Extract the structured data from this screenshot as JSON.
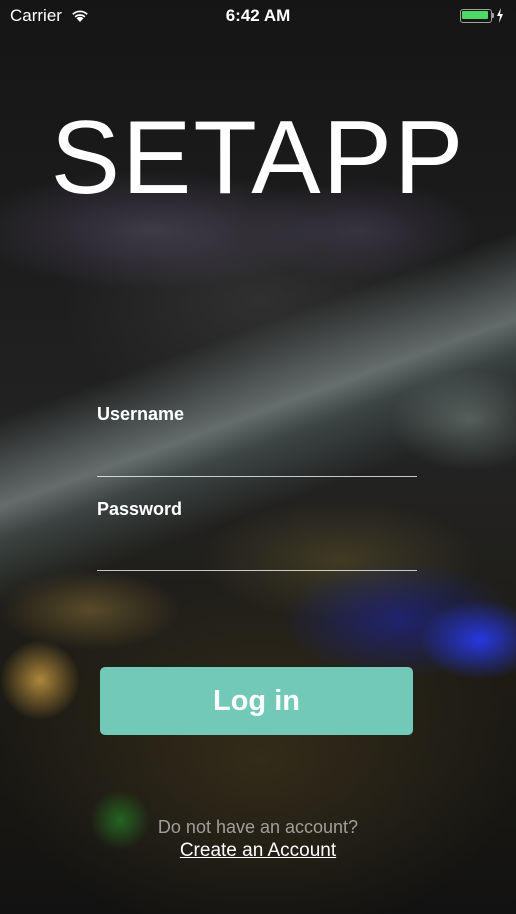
{
  "status_bar": {
    "carrier": "Carrier",
    "time": "6:42 AM",
    "battery_level": 1.0,
    "wifi_icon": "wifi-icon",
    "battery_icon": "battery-icon",
    "charging_icon": "charging-bolt-icon"
  },
  "logo": {
    "text": "SETAPP"
  },
  "login_form": {
    "username_label": "Username",
    "username_value": "",
    "password_label": "Password",
    "password_value": "",
    "login_button_label": "Log in"
  },
  "signup": {
    "prompt": "Do not have an account?",
    "link_label": "Create an Account"
  },
  "colors": {
    "accent": "#72c9b8",
    "battery": "#4cd964"
  }
}
